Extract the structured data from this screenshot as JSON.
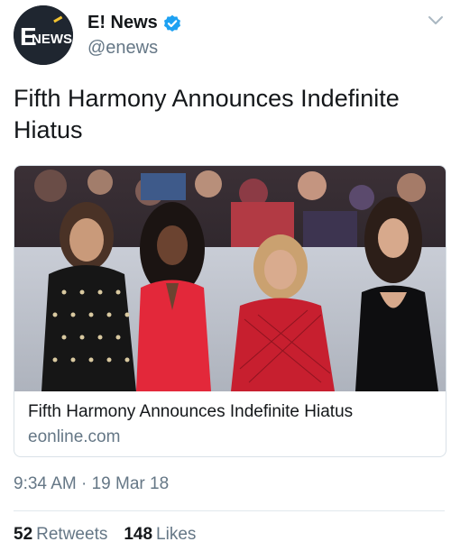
{
  "account": {
    "display_name": "E! News",
    "handle": "@enews",
    "avatar_text": "NEWS",
    "avatar_letter": "E"
  },
  "tweet": {
    "text": "Fifth Harmony Announces Indefinite Hiatus",
    "timestamp": "9:34 AM · 19 Mar 18"
  },
  "card": {
    "title": "Fifth Harmony Announces Indefinite Hiatus",
    "domain": "eonline.com"
  },
  "stats": {
    "retweets_count": "52",
    "retweets_label": "Retweets",
    "likes_count": "148",
    "likes_label": "Likes"
  },
  "colors": {
    "verified": "#1da1f2",
    "secondary_text": "#657786"
  }
}
